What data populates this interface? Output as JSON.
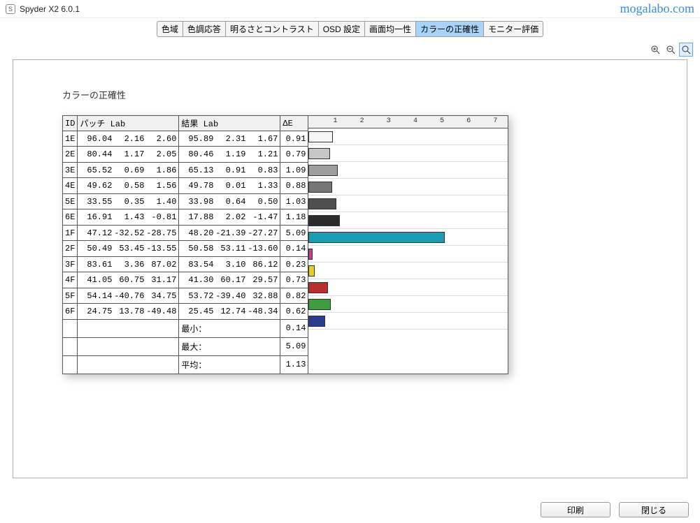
{
  "window": {
    "title": "Spyder X2 6.0.1",
    "watermark": "mogalabo.com"
  },
  "tabs": [
    {
      "label": "色域",
      "active": false
    },
    {
      "label": "色調応答",
      "active": false
    },
    {
      "label": "明るさとコントラスト",
      "active": false
    },
    {
      "label": "OSD 設定",
      "active": false
    },
    {
      "label": "画面均一性",
      "active": false
    },
    {
      "label": "カラーの正確性",
      "active": true
    },
    {
      "label": "モニター評価",
      "active": false
    }
  ],
  "section": {
    "title": "カラーの正確性"
  },
  "table": {
    "headers": {
      "id": "ID",
      "patch": "パッチ Lab",
      "result": "結果 Lab",
      "de": "ΔE"
    },
    "rows": [
      {
        "id": "1E",
        "pL": "96.04",
        "pa": "2.16",
        "pb": "2.60",
        "rL": "95.89",
        "ra": "2.31",
        "rb": "1.67",
        "de": "0.91",
        "color": "#f6f6f6"
      },
      {
        "id": "2E",
        "pL": "80.44",
        "pa": "1.17",
        "pb": "2.05",
        "rL": "80.46",
        "ra": "1.19",
        "rb": "1.21",
        "de": "0.79",
        "color": "#c7c7c7"
      },
      {
        "id": "3E",
        "pL": "65.52",
        "pa": "0.69",
        "pb": "1.86",
        "rL": "65.13",
        "ra": "0.91",
        "rb": "0.83",
        "de": "1.09",
        "color": "#9e9e9e"
      },
      {
        "id": "4E",
        "pL": "49.62",
        "pa": "0.58",
        "pb": "1.56",
        "rL": "49.78",
        "ra": "0.01",
        "rb": "1.33",
        "de": "0.88",
        "color": "#757575"
      },
      {
        "id": "5E",
        "pL": "33.55",
        "pa": "0.35",
        "pb": "1.40",
        "rL": "33.98",
        "ra": "0.64",
        "rb": "0.50",
        "de": "1.03",
        "color": "#4f4f4f"
      },
      {
        "id": "6E",
        "pL": "16.91",
        "pa": "1.43",
        "pb": "-0.81",
        "rL": "17.88",
        "ra": "2.02",
        "rb": "-1.47",
        "de": "1.18",
        "color": "#2b2b2b"
      },
      {
        "id": "1F",
        "pL": "47.12",
        "pa": "-32.52",
        "pb": "-28.75",
        "rL": "48.20",
        "ra": "-21.39",
        "rb": "-27.27",
        "de": "5.09",
        "color": "#1b9cb0"
      },
      {
        "id": "2F",
        "pL": "50.49",
        "pa": "53.45",
        "pb": "-13.55",
        "rL": "50.58",
        "ra": "53.11",
        "rb": "-13.60",
        "de": "0.14",
        "color": "#c5418f"
      },
      {
        "id": "3F",
        "pL": "83.61",
        "pa": "3.36",
        "pb": "87.02",
        "rL": "83.54",
        "ra": "3.10",
        "rb": "86.12",
        "de": "0.23",
        "color": "#e8ce1e"
      },
      {
        "id": "4F",
        "pL": "41.05",
        "pa": "60.75",
        "pb": "31.17",
        "rL": "41.30",
        "ra": "60.17",
        "rb": "29.57",
        "de": "0.73",
        "color": "#b82d2d"
      },
      {
        "id": "5F",
        "pL": "54.14",
        "pa": "-40.76",
        "pb": "34.75",
        "rL": "53.72",
        "ra": "-39.40",
        "rb": "32.88",
        "de": "0.82",
        "color": "#3f9b3f"
      },
      {
        "id": "6F",
        "pL": "24.75",
        "pa": "13.78",
        "pb": "-49.48",
        "rL": "25.45",
        "ra": "12.74",
        "rb": "-48.34",
        "de": "0.62",
        "color": "#2b3c8f"
      }
    ],
    "summary": [
      {
        "label": "最小：",
        "value": "0.14"
      },
      {
        "label": "最大：",
        "value": "5.09"
      },
      {
        "label": "平均：",
        "value": "1.13"
      }
    ]
  },
  "chart_data": {
    "type": "bar",
    "categories": [
      "1E",
      "2E",
      "3E",
      "4E",
      "5E",
      "6E",
      "1F",
      "2F",
      "3F",
      "4F",
      "5F",
      "6F"
    ],
    "values": [
      0.91,
      0.79,
      1.09,
      0.88,
      1.03,
      1.18,
      5.09,
      0.14,
      0.23,
      0.73,
      0.82,
      0.62
    ],
    "colors": [
      "#f6f6f6",
      "#c7c7c7",
      "#9e9e9e",
      "#757575",
      "#4f4f4f",
      "#2b2b2b",
      "#1b9cb0",
      "#c5418f",
      "#e8ce1e",
      "#b82d2d",
      "#3f9b3f",
      "#2b3c8f"
    ],
    "xlabel": "",
    "ylabel": "",
    "title": "",
    "ticks": [
      1,
      2,
      3,
      4,
      5,
      6,
      7
    ],
    "xlim": [
      0,
      7.5
    ]
  },
  "footer": {
    "print": "印刷",
    "close": "閉じる"
  }
}
